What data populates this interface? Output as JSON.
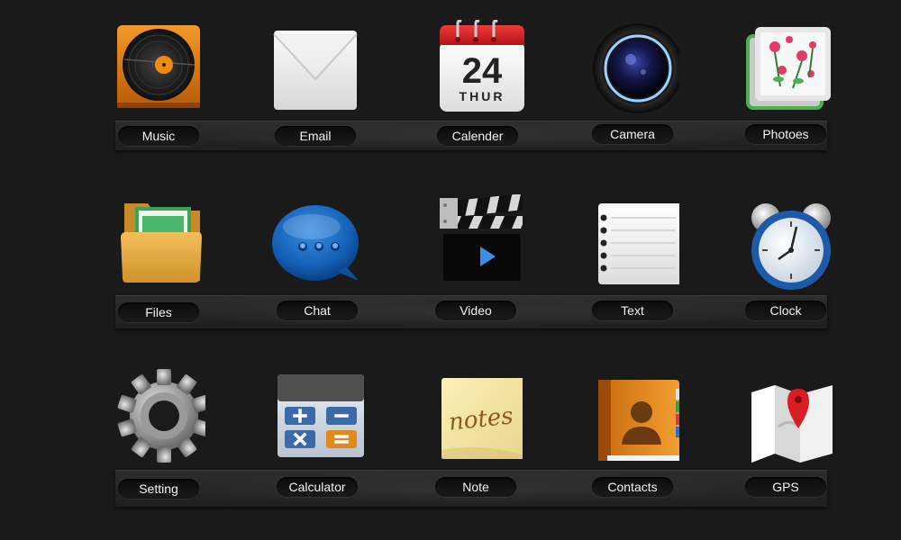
{
  "apps": {
    "music": {
      "label": "Music",
      "icon": "music-icon"
    },
    "email": {
      "label": "Email",
      "icon": "email-icon"
    },
    "calendar": {
      "label": "Calender",
      "icon": "calendar-icon",
      "day": "24",
      "weekday": "THUR"
    },
    "camera": {
      "label": "Camera",
      "icon": "camera-icon"
    },
    "photos": {
      "label": "Photoes",
      "icon": "photos-icon"
    },
    "files": {
      "label": "Files",
      "icon": "folder-icon"
    },
    "chat": {
      "label": "Chat",
      "icon": "chat-bubble-icon"
    },
    "video": {
      "label": "Video",
      "icon": "clapperboard-icon"
    },
    "text": {
      "label": "Text",
      "icon": "notepad-icon"
    },
    "clock": {
      "label": "Clock",
      "icon": "alarm-clock-icon"
    },
    "setting": {
      "label": "Setting",
      "icon": "gear-icon"
    },
    "calculator": {
      "label": "Calculator",
      "icon": "calculator-icon"
    },
    "note": {
      "label": "Note",
      "icon": "sticky-note-icon",
      "note_text": "notes"
    },
    "contacts": {
      "label": "Contacts",
      "icon": "address-book-icon"
    },
    "gps": {
      "label": "GPS",
      "icon": "map-pin-icon"
    }
  },
  "colors": {
    "background": "#1a1a1a",
    "shelf": "#262626",
    "label_text": "#f2f2f2",
    "calendar_red": "#d81e24",
    "music_orange": "#e07a10"
  }
}
